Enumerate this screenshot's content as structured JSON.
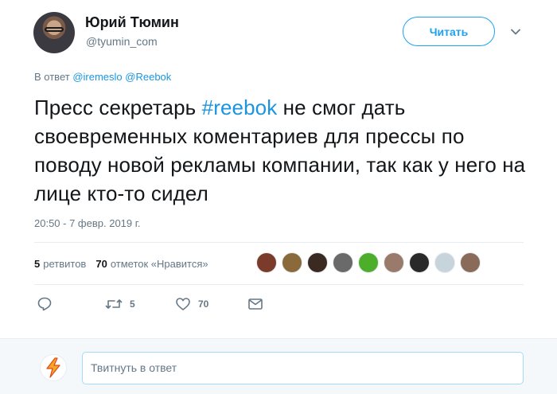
{
  "author": {
    "name": "Юрий Тюмин",
    "handle": "@tyumin_com"
  },
  "follow_button": {
    "label": "Читать"
  },
  "reply_to": {
    "prefix": "В ответ",
    "mentions": [
      "@iremeslo",
      "@Reebok"
    ]
  },
  "tweet": {
    "text_before": "Пресс секретарь ",
    "hashtag": "#reebok",
    "text_after": " не смог дать своевременных коментариев для прессы по поводу новой рекламы компании, так как у него на лице кто-то сидел",
    "timestamp": "20:50 - 7 февр. 2019 г."
  },
  "stats": {
    "retweets_count": "5",
    "retweets_label": "ретвитов",
    "likes_count": "70",
    "likes_label": "отметок «Нравится»"
  },
  "likers": [
    {
      "color": "#7a3b2a"
    },
    {
      "color": "#8a6a3a"
    },
    {
      "color": "#3a2a22"
    },
    {
      "color": "#6a6a6a"
    },
    {
      "color": "#4cae2a"
    },
    {
      "color": "#9a7a6a"
    },
    {
      "color": "#2a2a2a"
    },
    {
      "color": "#c8d4dc"
    },
    {
      "color": "#8a6a58"
    }
  ],
  "actions": {
    "reply_icon": "reply-icon",
    "retweet_icon": "retweet-icon",
    "retweet_count": "5",
    "like_icon": "heart-icon",
    "like_count": "70",
    "dm_icon": "envelope-icon"
  },
  "reply_box": {
    "placeholder": "Твитнуть в ответ"
  },
  "colors": {
    "accent": "#1da1f2",
    "link": "#1b95e0",
    "muted": "#657786",
    "text": "#14171a"
  }
}
